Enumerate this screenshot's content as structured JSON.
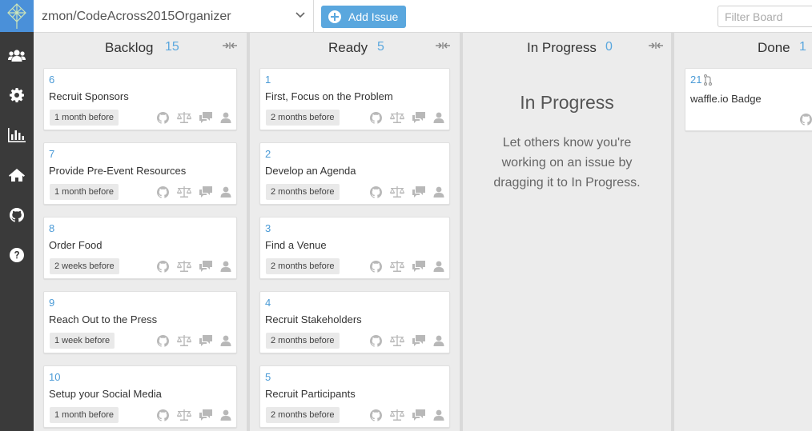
{
  "app": {
    "repo": "zmon/CodeAcross2015Organizer",
    "add_issue_label": "Add Issue",
    "filter_placeholder": "Filter Board"
  },
  "colors": {
    "accent": "#5aa7de",
    "sidebar": "#3a3a3a",
    "logo_bg": "#4a90d9",
    "issue_number": "#4a9ad6"
  },
  "sidebar": {
    "items": [
      {
        "icon": "users-icon"
      },
      {
        "icon": "gear-icon"
      },
      {
        "icon": "bar-chart-icon"
      },
      {
        "icon": "home-icon"
      },
      {
        "icon": "github-icon"
      },
      {
        "icon": "help-icon"
      }
    ]
  },
  "columns": {
    "backlog": {
      "title": "Backlog",
      "count": "15",
      "cards": [
        {
          "number": "6",
          "title": "Recruit Sponsors",
          "label": "1 month before"
        },
        {
          "number": "7",
          "title": "Provide Pre-Event Resources",
          "label": "1 month before"
        },
        {
          "number": "8",
          "title": "Order Food",
          "label": "2 weeks before"
        },
        {
          "number": "9",
          "title": "Reach Out to the Press",
          "label": "1 week before"
        },
        {
          "number": "10",
          "title": "Setup your Social Media",
          "label": "1 month before"
        }
      ]
    },
    "ready": {
      "title": "Ready",
      "count": "5",
      "cards": [
        {
          "number": "1",
          "title": "First, Focus on the Problem",
          "label": "2 months before"
        },
        {
          "number": "2",
          "title": "Develop an Agenda",
          "label": "2 months before"
        },
        {
          "number": "3",
          "title": "Find a Venue",
          "label": "2 months before"
        },
        {
          "number": "4",
          "title": "Recruit Stakeholders",
          "label": "2 months before"
        },
        {
          "number": "5",
          "title": "Recruit Participants",
          "label": "2 months before"
        }
      ]
    },
    "in_progress": {
      "title": "In Progress",
      "count": "0",
      "empty_title": "In Progress",
      "empty_text": "Let others know you're working on an issue by dragging it to In Progress."
    },
    "done": {
      "title": "Done",
      "count": "1",
      "cards": [
        {
          "number": "21",
          "title": "waffle.io Badge"
        }
      ]
    }
  }
}
